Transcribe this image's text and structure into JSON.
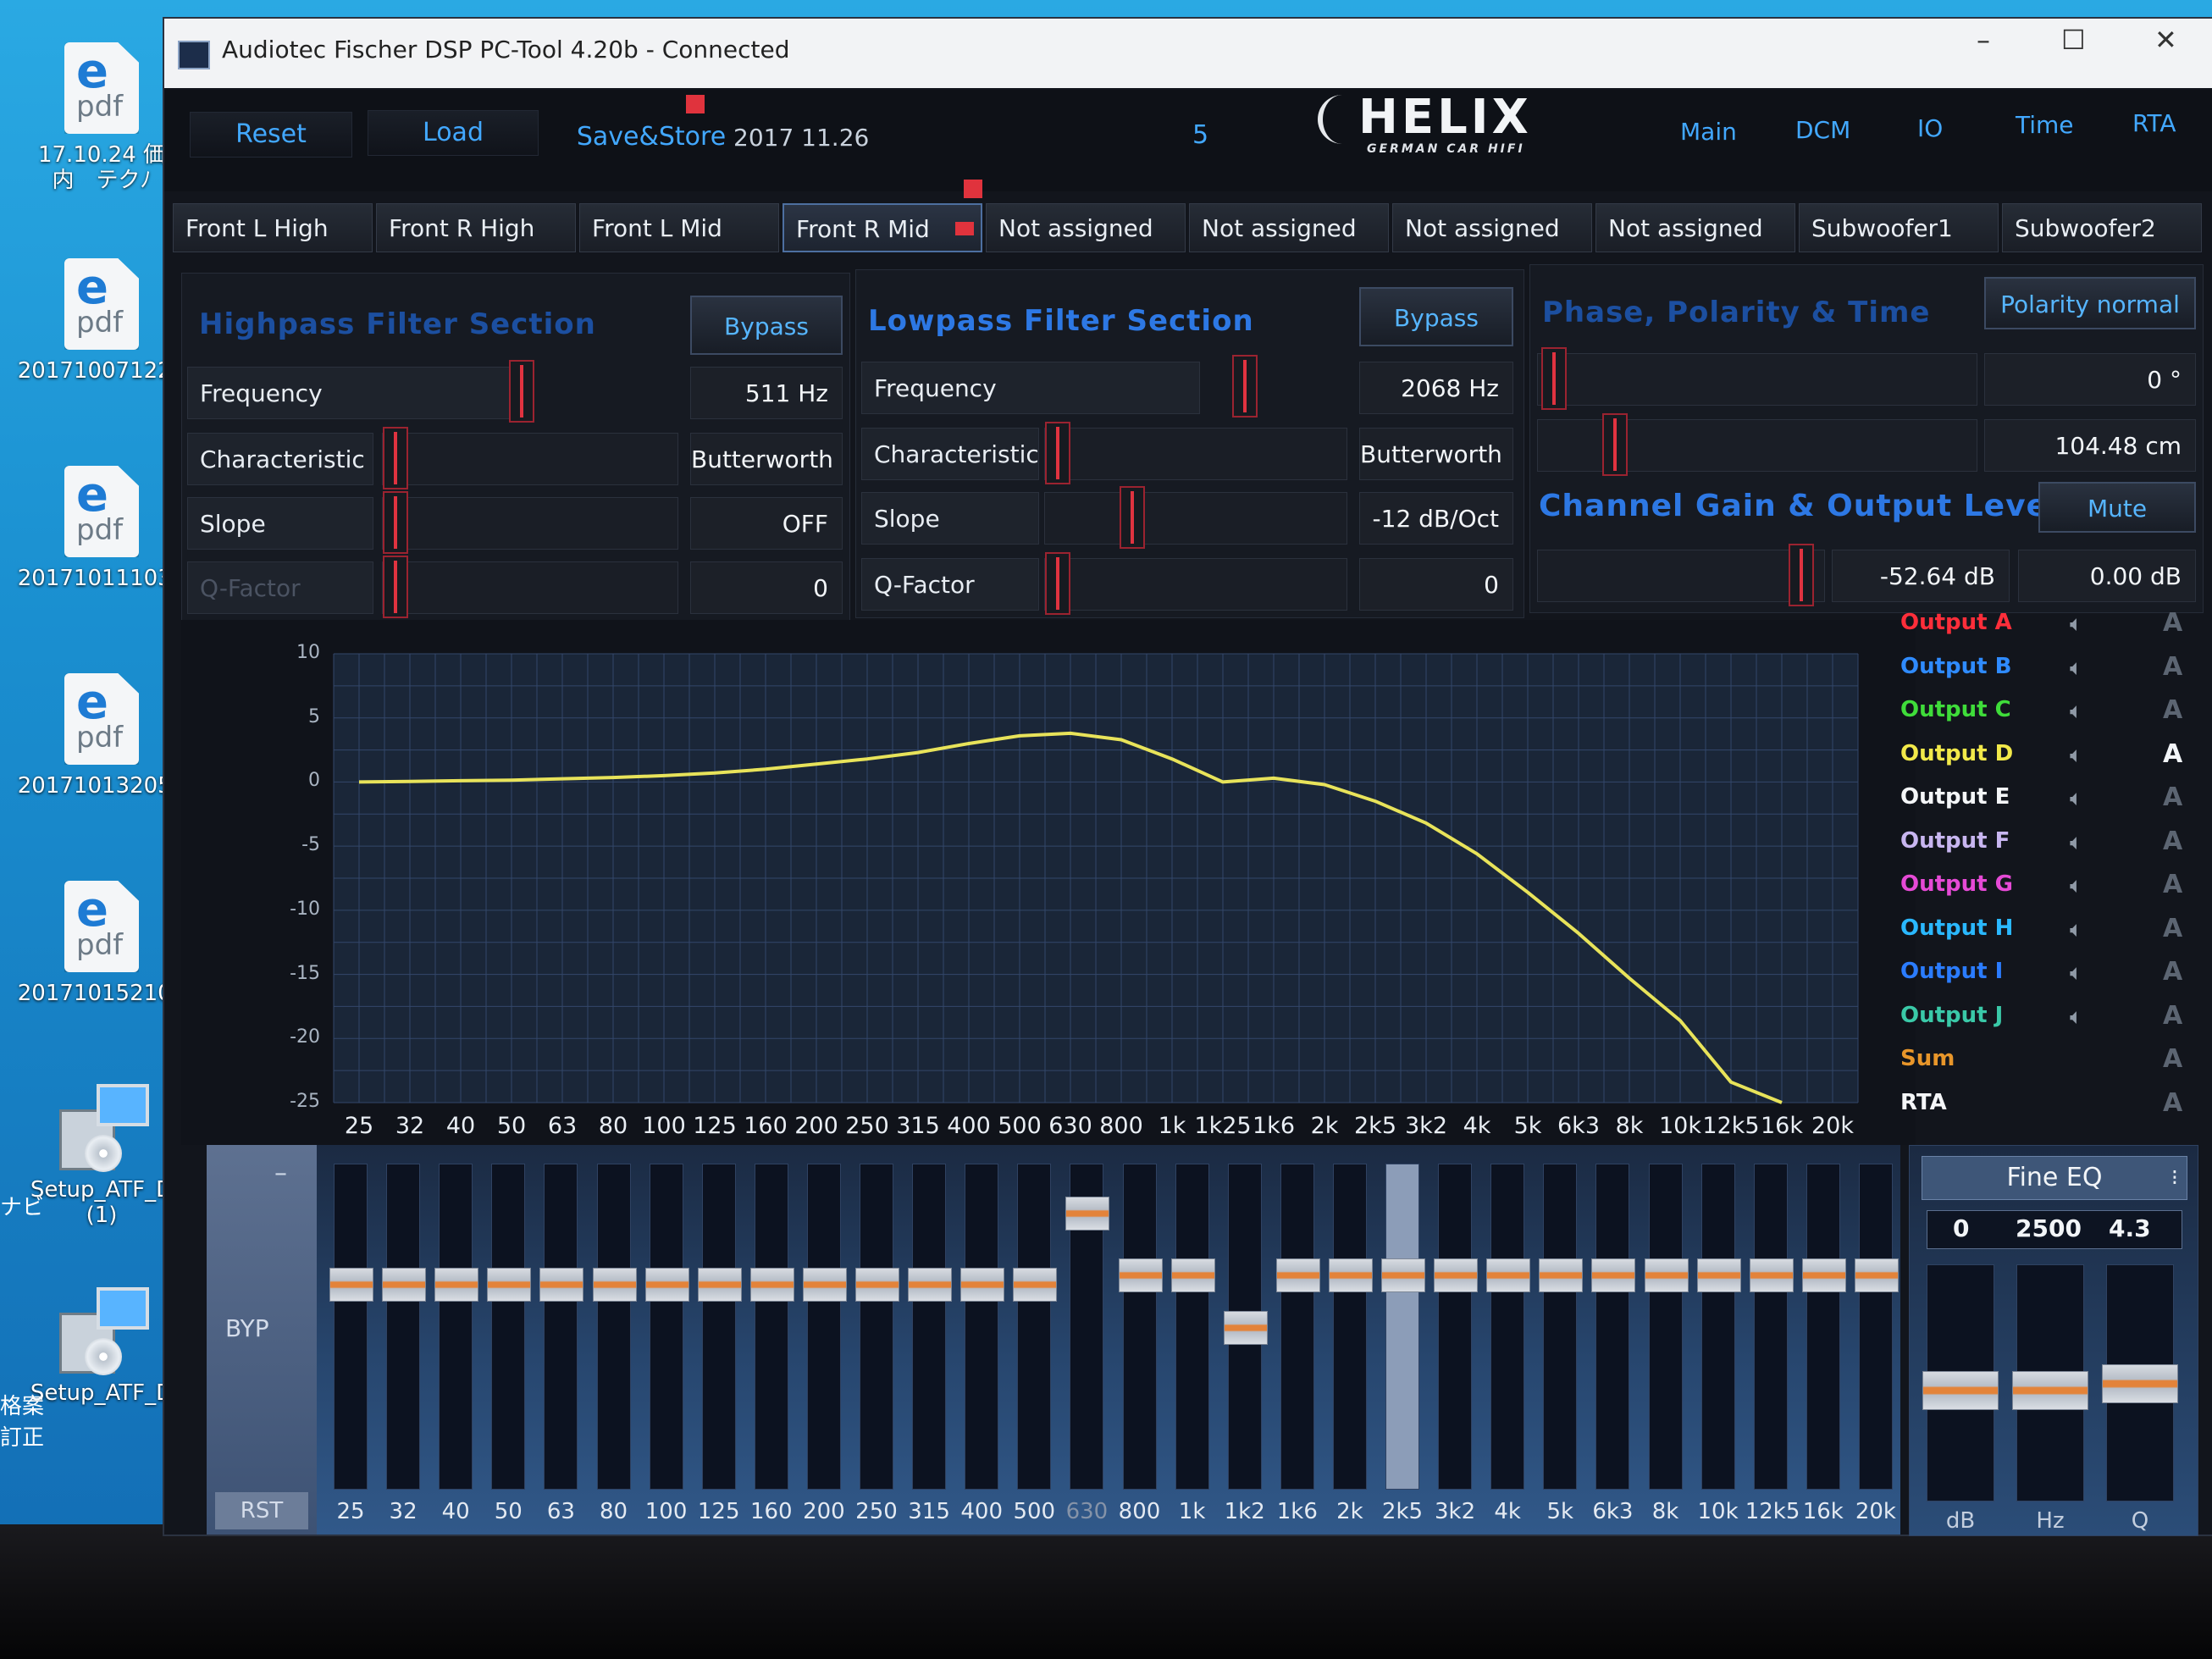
{
  "desktop": {
    "icons": [
      {
        "glyph": "pdf",
        "label": "17.10.24 価\n内　テクﾉ",
        "top": 50
      },
      {
        "glyph": "pdf",
        "label": "201710071223",
        "top": 305
      },
      {
        "glyph": "pdf",
        "label": "201710111033",
        "top": 550
      },
      {
        "glyph": "pdf",
        "label": "201710132054",
        "top": 795
      },
      {
        "glyph": "pdf",
        "label": "201710152105",
        "top": 1040
      },
      {
        "glyph": "setup",
        "label": "Setup_ATF_D\n(1)",
        "top": 1280
      },
      {
        "glyph": "setup",
        "label": "Setup_ATF_D",
        "top": 1520
      }
    ],
    "left_edge_labels": [
      "ナビ",
      "格案\n訂正"
    ]
  },
  "window": {
    "title": "Audiotec Fischer DSP PC-Tool 4.20b - Connected",
    "min": "–",
    "max": "☐",
    "close": "✕"
  },
  "toolbar": {
    "reset": "Reset",
    "load": "Load",
    "save_store": "Save&Store",
    "date": "2017 11.26",
    "preset": "5"
  },
  "logo": {
    "word": "HELIX",
    "sub": "GERMAN CAR HIFI"
  },
  "nav": [
    "Main",
    "DCM",
    "IO",
    "Time",
    "RTA"
  ],
  "channels": [
    "Front L High",
    "Front R High",
    "Front L Mid",
    "Front R Mid",
    "Not assigned",
    "Not assigned",
    "Not assigned",
    "Not assigned",
    "Subwoofer1",
    "Subwoofer2"
  ],
  "active_channel": 3,
  "highpass": {
    "title": "Highpass Filter Section",
    "bypass": "Bypass",
    "frequency_label": "Frequency",
    "frequency_value": "511 Hz",
    "characteristic_label": "Characteristic",
    "characteristic_value": "Butterworth",
    "slope_label": "Slope",
    "slope_value": "OFF",
    "qfactor_label": "Q-Factor",
    "qfactor_value": "0"
  },
  "lowpass": {
    "title": "Lowpass Filter Section",
    "bypass": "Bypass",
    "frequency_label": "Frequency",
    "frequency_value": "2068 Hz",
    "characteristic_label": "Characteristic",
    "characteristic_value": "Butterworth",
    "slope_label": "Slope",
    "slope_value": "-12 dB/Oct",
    "qfactor_label": "Q-Factor",
    "qfactor_value": "0"
  },
  "phase": {
    "title": "Phase, Polarity & Time",
    "polarity": "Polarity normal",
    "phase_value": "0 °",
    "time_value": "104.48 cm"
  },
  "gain": {
    "title": "Channel Gain & Output Level",
    "mute": "Mute",
    "gain_value": "-52.64 dB",
    "level_value": "0.00 dB"
  },
  "graph": {
    "y_ticks": [
      "10",
      "5",
      "0",
      "-5",
      "-10",
      "-15",
      "-20",
      "-25"
    ],
    "x_ticks": [
      "25",
      "32",
      "40",
      "50",
      "63",
      "80",
      "100",
      "125",
      "160",
      "200",
      "250",
      "315",
      "400",
      "500",
      "630",
      "800",
      "1k",
      "1k25",
      "1k6",
      "2k",
      "2k5",
      "3k2",
      "4k",
      "5k",
      "6k3",
      "8k",
      "10k",
      "12k5",
      "16k",
      "20k"
    ],
    "curve_color": "#e8e35a",
    "curve_db": [
      0,
      0.05,
      0.1,
      0.15,
      0.25,
      0.35,
      0.5,
      0.7,
      1.0,
      1.4,
      1.8,
      2.3,
      3.0,
      3.6,
      3.8,
      3.3,
      1.8,
      0.0,
      0.3,
      -0.2,
      -1.5,
      -3.2,
      -5.6,
      -8.6,
      -11.8,
      -15.3,
      -18.6,
      -23.4,
      -27,
      -30
    ]
  },
  "outputs": [
    {
      "name": "Output A",
      "color": "#ff2e3a",
      "active": false
    },
    {
      "name": "Output B",
      "color": "#2f8bff",
      "active": false
    },
    {
      "name": "Output C",
      "color": "#3fdc3a",
      "active": false
    },
    {
      "name": "Output D",
      "color": "#f2e94a",
      "active": true
    },
    {
      "name": "Output E",
      "color": "#f4f6f8",
      "active": false
    },
    {
      "name": "Output F",
      "color": "#c8b6f0",
      "active": false
    },
    {
      "name": "Output G",
      "color": "#e64ad6",
      "active": false
    },
    {
      "name": "Output H",
      "color": "#2ab8ff",
      "active": false
    },
    {
      "name": "Output I",
      "color": "#2b7cff",
      "active": false
    },
    {
      "name": "Output J",
      "color": "#3ac9a8",
      "active": false
    },
    {
      "name": "Sum",
      "color": "#e8962a",
      "active": false
    },
    {
      "name": "RTA",
      "color": "#f4f6f8",
      "active": false
    }
  ],
  "output_speaker_icon": "speaker-icon",
  "output_a_glyph": "A",
  "eq": {
    "byp_minus": "–",
    "byp": "BYP",
    "rst": "RST",
    "labels": [
      "25",
      "32",
      "40",
      "50",
      "63",
      "80",
      "100",
      "125",
      "160",
      "200",
      "250",
      "315",
      "400",
      "500",
      "630",
      "800",
      "1k",
      "1k2",
      "1k6",
      "2k",
      "2k5",
      "3k2",
      "4k",
      "5k",
      "6k3",
      "8k",
      "10k",
      "12k5",
      "16k",
      "20k"
    ],
    "band_levels": [
      0.63,
      0.63,
      0.63,
      0.63,
      0.63,
      0.63,
      0.63,
      0.63,
      0.63,
      0.63,
      0.63,
      0.63,
      0.63,
      0.63,
      0.85,
      0.66,
      0.66,
      0.5,
      0.66,
      0.66,
      0.66,
      0.66,
      0.66,
      0.66,
      0.66,
      0.66,
      0.66,
      0.66,
      0.66,
      0.66
    ],
    "highlight_band": 20
  },
  "fine_eq": {
    "mode": "Fine EQ",
    "arrow": "⁝",
    "db": "0",
    "hz": "2500",
    "q": "4.3",
    "label_db": "dB",
    "label_hz": "Hz",
    "label_q": "Q",
    "levels": [
      0.47,
      0.47,
      0.5
    ]
  }
}
